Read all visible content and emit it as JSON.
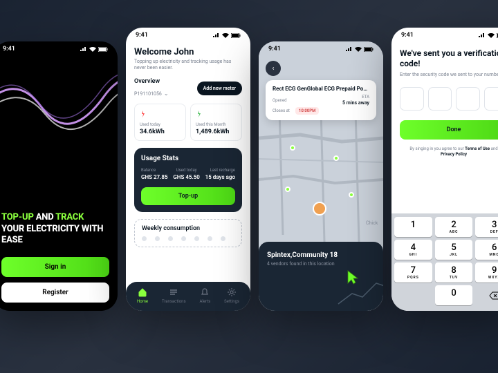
{
  "status": {
    "time": "9:41"
  },
  "s1": {
    "title_part1": "TOP-UP",
    "title_and": "AND",
    "title_part2": "TRACK",
    "title_rest": "YOUR ELECTRICITY WITH EASE",
    "signin": "Sign in",
    "register": "Register"
  },
  "s2": {
    "welcome": "Welcome John",
    "subtitle": "Topping up electricity and tracking usage has never been easier.",
    "overview": "Overview",
    "meter_id": "P191101056",
    "new_meter": "Add new meter",
    "used_today_label": "Used today",
    "used_today_val": "34.6kWh",
    "used_month_label": "Used this Month",
    "used_month_val": "1,489.6kWh",
    "usage_title": "Usage Stats",
    "balance_label": "Balance",
    "balance_val": "GHS 27.85",
    "used_today2_label": "Used today",
    "used_today2_val": "GHS 45.50",
    "recharge_label": "Last recharge",
    "recharge_val": "15 days ago",
    "topup": "Top-up",
    "weekly": "Weekly consumption",
    "nav": {
      "home": "Home",
      "transactions": "Transactions",
      "alerts": "Alerts",
      "settings": "Settings"
    }
  },
  "s3": {
    "card_title": "Rect ECG GenGlobal ECG Prepaid Po…",
    "opened": "Opened",
    "closes": "Closes at",
    "closes_time": "10:00PM",
    "eta_label": "ETA",
    "eta_val": "5 mins away",
    "location": "Spintex,Community 18",
    "vendors": "4 vendors found in this location",
    "map_label": "Chick"
  },
  "s4": {
    "title": "We've sent you a verification code!",
    "subtitle": "Enter the security code we sent to your number",
    "done": "Done",
    "terms_pre": "By singing in you agree to our ",
    "terms": "Terms of Use",
    "terms_and": " and ",
    "privacy": "Privacy Policy",
    "keys": [
      {
        "n": "1",
        "l": ""
      },
      {
        "n": "2",
        "l": "ABC"
      },
      {
        "n": "3",
        "l": "DEF"
      },
      {
        "n": "4",
        "l": "GHI"
      },
      {
        "n": "5",
        "l": "JKL"
      },
      {
        "n": "6",
        "l": "MNO"
      },
      {
        "n": "7",
        "l": "PQRS"
      },
      {
        "n": "8",
        "l": "TUV"
      },
      {
        "n": "9",
        "l": "WXYZ"
      },
      {
        "n": "0",
        "l": ""
      }
    ]
  }
}
